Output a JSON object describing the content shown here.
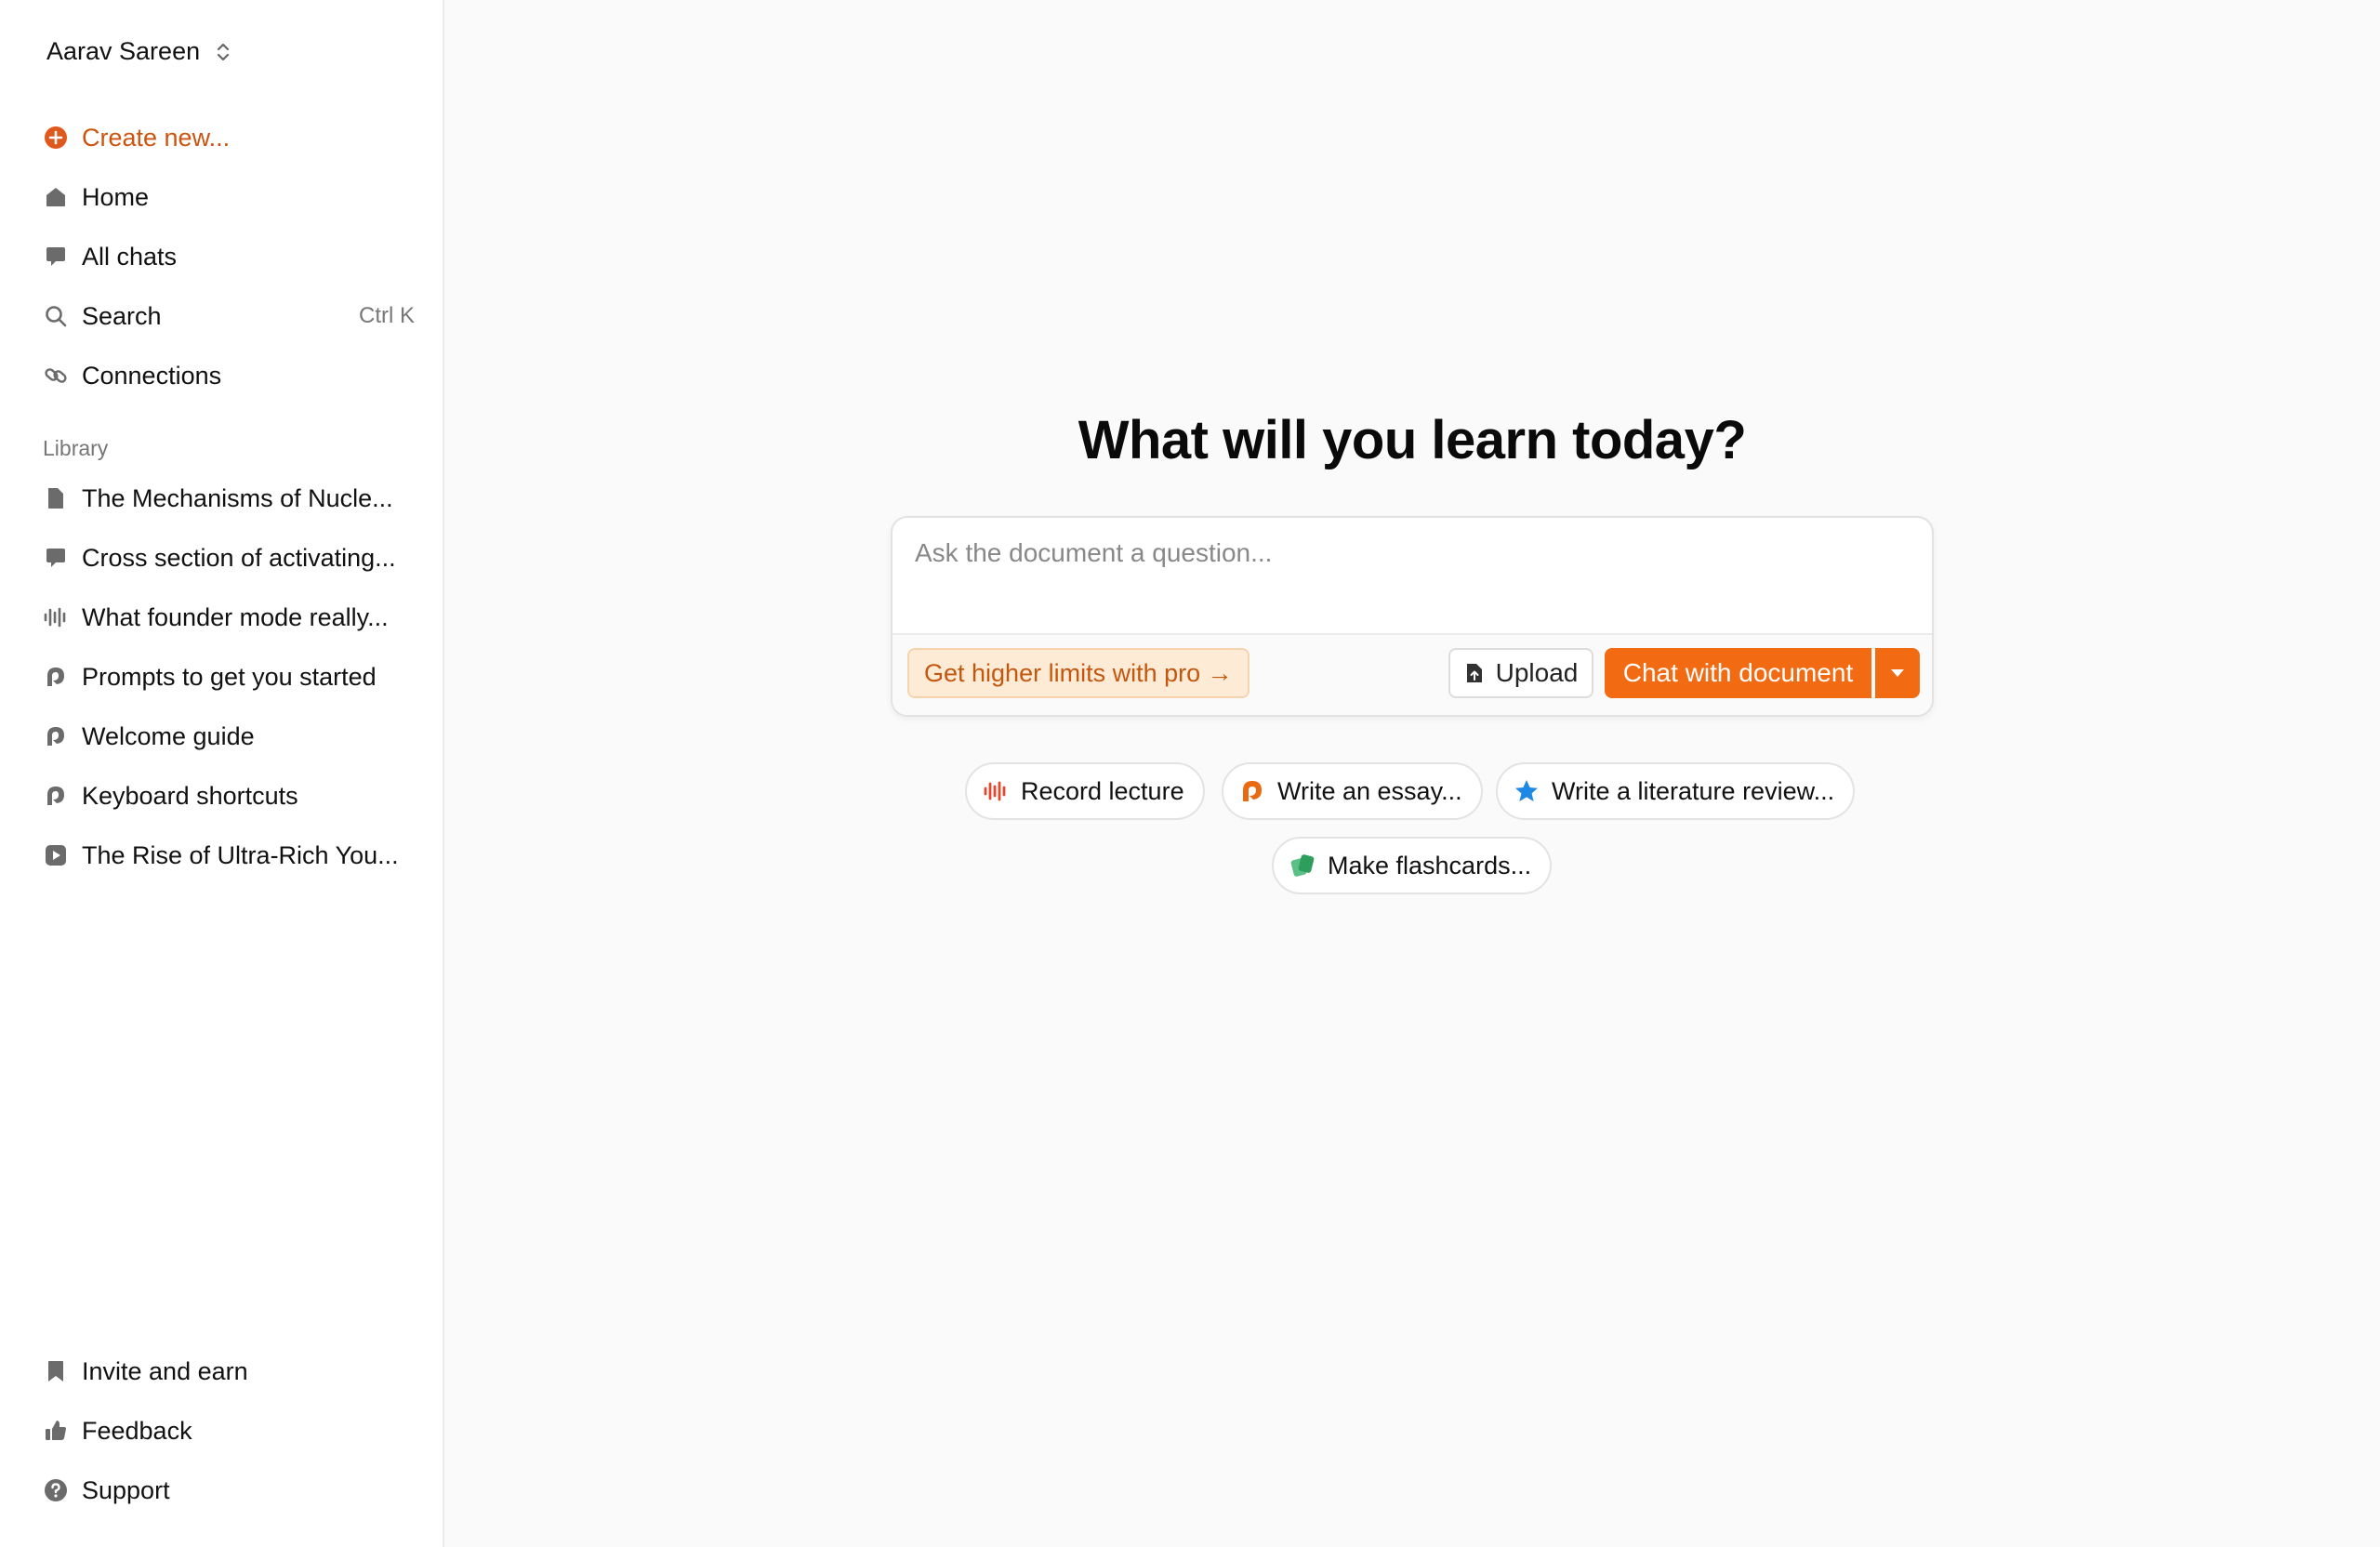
{
  "user": {
    "name": "Aarav Sareen",
    "switcher_icon": "chevron-up-down-icon"
  },
  "nav": {
    "create_new": "Create new...",
    "home": "Home",
    "all_chats": "All chats",
    "search": "Search",
    "search_shortcut": "Ctrl K",
    "connections": "Connections"
  },
  "library": {
    "title": "Library",
    "items": [
      {
        "label": "The Mechanisms of Nucle...",
        "icon": "document-icon"
      },
      {
        "label": "Cross section of activating...",
        "icon": "chat-icon"
      },
      {
        "label": "What founder mode really...",
        "icon": "audio-wave-icon"
      },
      {
        "label": "Prompts to get you started",
        "icon": "note-icon"
      },
      {
        "label": "Welcome guide",
        "icon": "note-icon"
      },
      {
        "label": "Keyboard shortcuts",
        "icon": "note-icon"
      },
      {
        "label": "The Rise of Ultra-Rich You...",
        "icon": "video-icon"
      }
    ]
  },
  "footer_nav": {
    "invite": "Invite and earn",
    "feedback": "Feedback",
    "support": "Support"
  },
  "main": {
    "headline": "What will you learn today?",
    "composer": {
      "placeholder": "Ask the document a question...",
      "pro_button": "Get higher limits with pro →",
      "upload_button": "Upload",
      "primary_button": "Chat with document"
    },
    "chips": [
      {
        "label": "Record lecture",
        "icon": "audio-wave-icon",
        "color": "#e2482e"
      },
      {
        "label": "Write an essay...",
        "icon": "note-icon",
        "color": "#ea6a12"
      },
      {
        "label": "Write a literature review...",
        "icon": "star-icon",
        "color": "#1e88e5"
      },
      {
        "label": "Make flashcards...",
        "icon": "flashcards-icon",
        "color": "#2e9e5c"
      }
    ]
  },
  "colors": {
    "accent": "#f26a12",
    "accent_text": "#cc5410",
    "pro_bg": "#fdebd6",
    "icon_gray": "#6b6b6b"
  }
}
